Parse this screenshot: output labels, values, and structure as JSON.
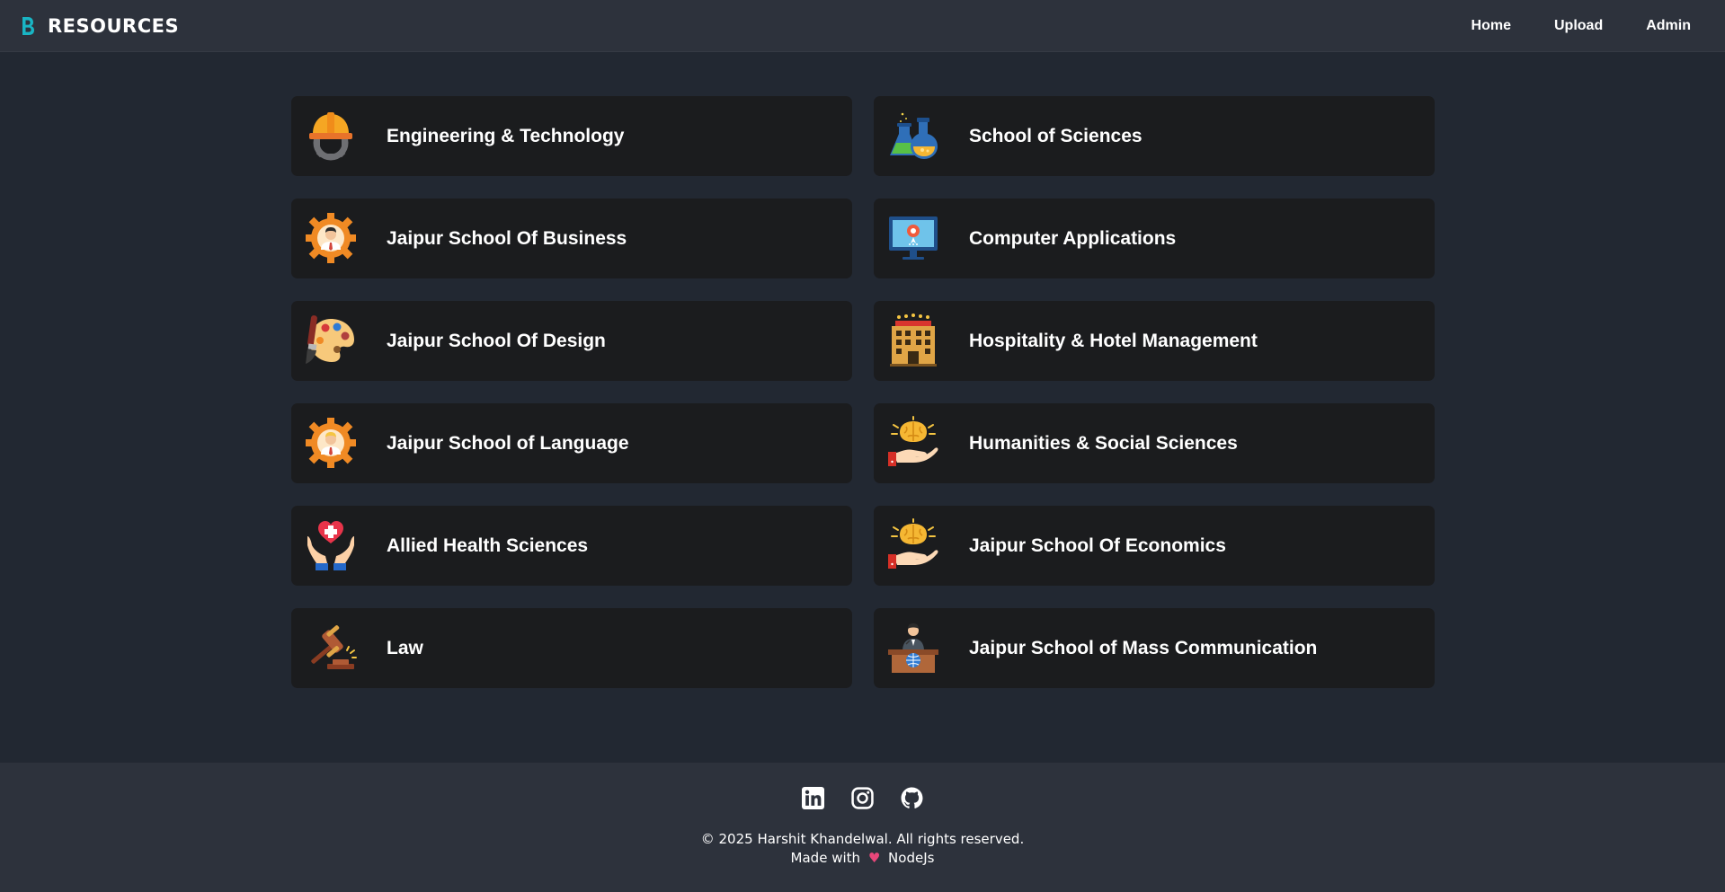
{
  "header": {
    "brand_letter": "B",
    "brand_text": "RESOURCES",
    "nav": [
      "Home",
      "Upload",
      "Admin"
    ]
  },
  "schools": [
    {
      "label": "Engineering & Technology",
      "icon": "hard-hat-gear-icon"
    },
    {
      "label": "School of Sciences",
      "icon": "flasks-icon"
    },
    {
      "label": "Jaipur School Of Business",
      "icon": "businessman-gear-icon"
    },
    {
      "label": "Computer Applications",
      "icon": "monitor-icon"
    },
    {
      "label": "Jaipur School Of Design",
      "icon": "palette-icon"
    },
    {
      "label": "Hospitality & Hotel Management",
      "icon": "hotel-building-icon"
    },
    {
      "label": "Jaipur School of Language",
      "icon": "person-gear-icon"
    },
    {
      "label": "Humanities & Social Sciences",
      "icon": "brain-hand-icon"
    },
    {
      "label": "Allied Health Sciences",
      "icon": "heart-hands-icon"
    },
    {
      "label": "Jaipur School Of Economics",
      "icon": "brain-hand-icon"
    },
    {
      "label": "Law",
      "icon": "gavel-icon"
    },
    {
      "label": "Jaipur School of Mass Communication",
      "icon": "speaker-podium-icon"
    }
  ],
  "footer": {
    "social": [
      "linkedin-icon",
      "instagram-icon",
      "github-icon"
    ],
    "copyright": "© 2025 Harshit Khandelwal. All rights reserved.",
    "made_prefix": "Made with",
    "heart": "♥",
    "made_suffix": "NodeJs"
  },
  "colors": {
    "background": "#222832",
    "navbar": "#2d323c",
    "card": "#1b1c1e",
    "brand_accent": "#19b5c4",
    "heart": "#e8477a"
  }
}
